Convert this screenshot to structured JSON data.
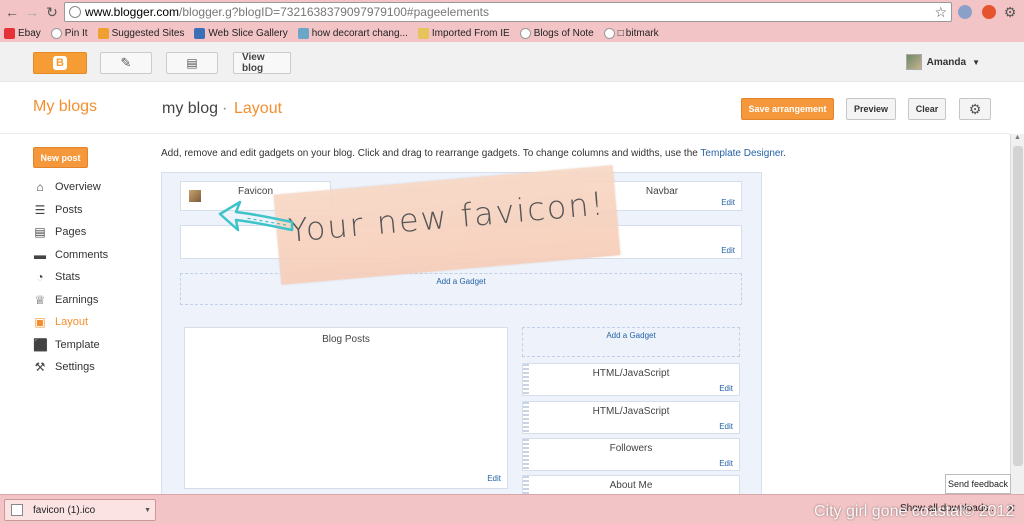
{
  "browser": {
    "url_host": "www.blogger.com",
    "url_path": "/blogger.g?blogID=7321638379097979100#pageelements",
    "bookmarks": [
      {
        "label": "Ebay",
        "icon": "ebay-icon",
        "color": "#e53238"
      },
      {
        "label": "Pin It",
        "icon": "pin-icon",
        "color": "#999999"
      },
      {
        "label": "Suggested Sites",
        "icon": "suggested-icon",
        "color": "#f0a030"
      },
      {
        "label": "Web Slice Gallery",
        "icon": "webslice-icon",
        "color": "#3b6fb6"
      },
      {
        "label": "how decorart chang...",
        "icon": "diy-icon",
        "color": "#6aa6c8"
      },
      {
        "label": "Imported From IE",
        "icon": "folder-icon",
        "color": "#e8c25a"
      },
      {
        "label": "Blogs of Note",
        "icon": "globe-icon",
        "color": "#999999"
      },
      {
        "label": "bitmark",
        "icon": "globe-icon",
        "color": "#999999"
      }
    ],
    "bitmark_glyph": "□"
  },
  "topbar": {
    "view_blog": "View blog",
    "user_name": "Amanda"
  },
  "header": {
    "my_blogs": "My blogs",
    "blog_name": "my blog",
    "separator": "·",
    "section": "Layout",
    "save_label": "Save arrangement",
    "preview_label": "Preview",
    "clear_label": "Clear"
  },
  "sidebar": {
    "new_post": "New post",
    "items": [
      {
        "label": "Overview",
        "icon": "home-icon",
        "glyph": "⌂"
      },
      {
        "label": "Posts",
        "icon": "posts-icon",
        "glyph": "☰"
      },
      {
        "label": "Pages",
        "icon": "pages-icon",
        "glyph": "▤"
      },
      {
        "label": "Comments",
        "icon": "comments-icon",
        "glyph": "▬"
      },
      {
        "label": "Stats",
        "icon": "stats-icon",
        "glyph": "◔"
      },
      {
        "label": "Earnings",
        "icon": "trophy-icon",
        "glyph": "♕"
      },
      {
        "label": "Layout",
        "icon": "layout-icon",
        "glyph": "▣",
        "active": true
      },
      {
        "label": "Template",
        "icon": "template-icon",
        "glyph": "⬛"
      },
      {
        "label": "Settings",
        "icon": "wrench-icon",
        "glyph": "⚒"
      }
    ]
  },
  "content": {
    "intro": "Add, remove and edit gadgets on your blog. Click and drag to rearrange gadgets. To change columns and widths, use the ",
    "intro_link": "Template Designer",
    "intro_end": ".",
    "favicon": "Favicon",
    "navbar": "Navbar",
    "edit": "Edit",
    "add_gadget": "Add a Gadget",
    "blog_posts": "Blog Posts",
    "sidebar_gadgets": [
      "HTML/JavaScript",
      "HTML/JavaScript",
      "Followers",
      "About Me"
    ],
    "annotation": "Your new favicon!"
  },
  "feedback": "Send feedback",
  "download": {
    "file": "favicon (1).ico",
    "show_all": "Show all downloads..."
  },
  "watermark": "City girl gone coastal© 2012",
  "colors": {
    "accent": "#f38f2f",
    "link": "#2563a6",
    "chrome": "#f3c4c6"
  }
}
